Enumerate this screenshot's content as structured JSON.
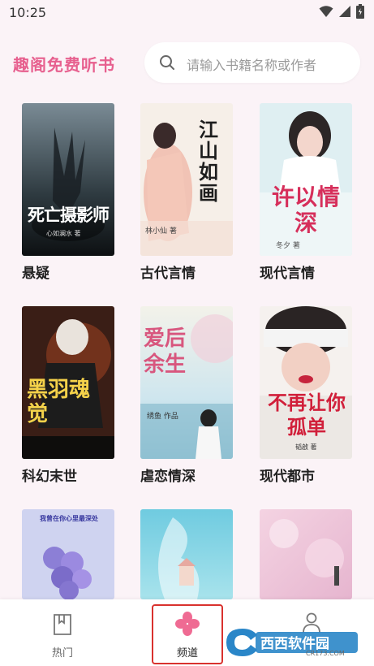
{
  "status_bar": {
    "time": "10:25",
    "icons": [
      "wifi-icon",
      "signal-icon",
      "battery-icon"
    ]
  },
  "header": {
    "app_title": "趣阁免费听书",
    "search_placeholder": "请输入书籍名称或作者"
  },
  "books": [
    {
      "category": "悬疑",
      "cover_title": "死亡摄影师",
      "cover_author": "心如澜水 著"
    },
    {
      "category": "古代言情",
      "cover_title": "江山如画",
      "cover_author": "林小仙 著"
    },
    {
      "category": "现代言情",
      "cover_title": "许以情深",
      "cover_author": "冬夕 著"
    },
    {
      "category": "科幻末世",
      "cover_title": "黑羽魂觉",
      "cover_author": ""
    },
    {
      "category": "虐恋情深",
      "cover_title": "爱后余生",
      "cover_author": "绣鱼 作品"
    },
    {
      "category": "现代都市",
      "cover_title": "不再让你孤单",
      "cover_author": "韬啟 著"
    },
    {
      "category": "",
      "cover_title": "我曾在你心里最深处",
      "cover_author": ""
    },
    {
      "category": "",
      "cover_title": "",
      "cover_author": ""
    },
    {
      "category": "",
      "cover_title": "",
      "cover_author": ""
    }
  ],
  "tabbar": {
    "items": [
      {
        "label": "热门",
        "icon": "bookmark-icon",
        "active": false
      },
      {
        "label": "频道",
        "icon": "channel-petals-icon",
        "active": true
      },
      {
        "label": "",
        "icon": "person-icon",
        "active": false
      }
    ]
  },
  "watermark": {
    "text": "西西软件园",
    "sub": "CR173.COM"
  },
  "colors": {
    "accent": "#e7608f",
    "background": "#fbf3f7",
    "highlight_box": "#d9322e"
  }
}
